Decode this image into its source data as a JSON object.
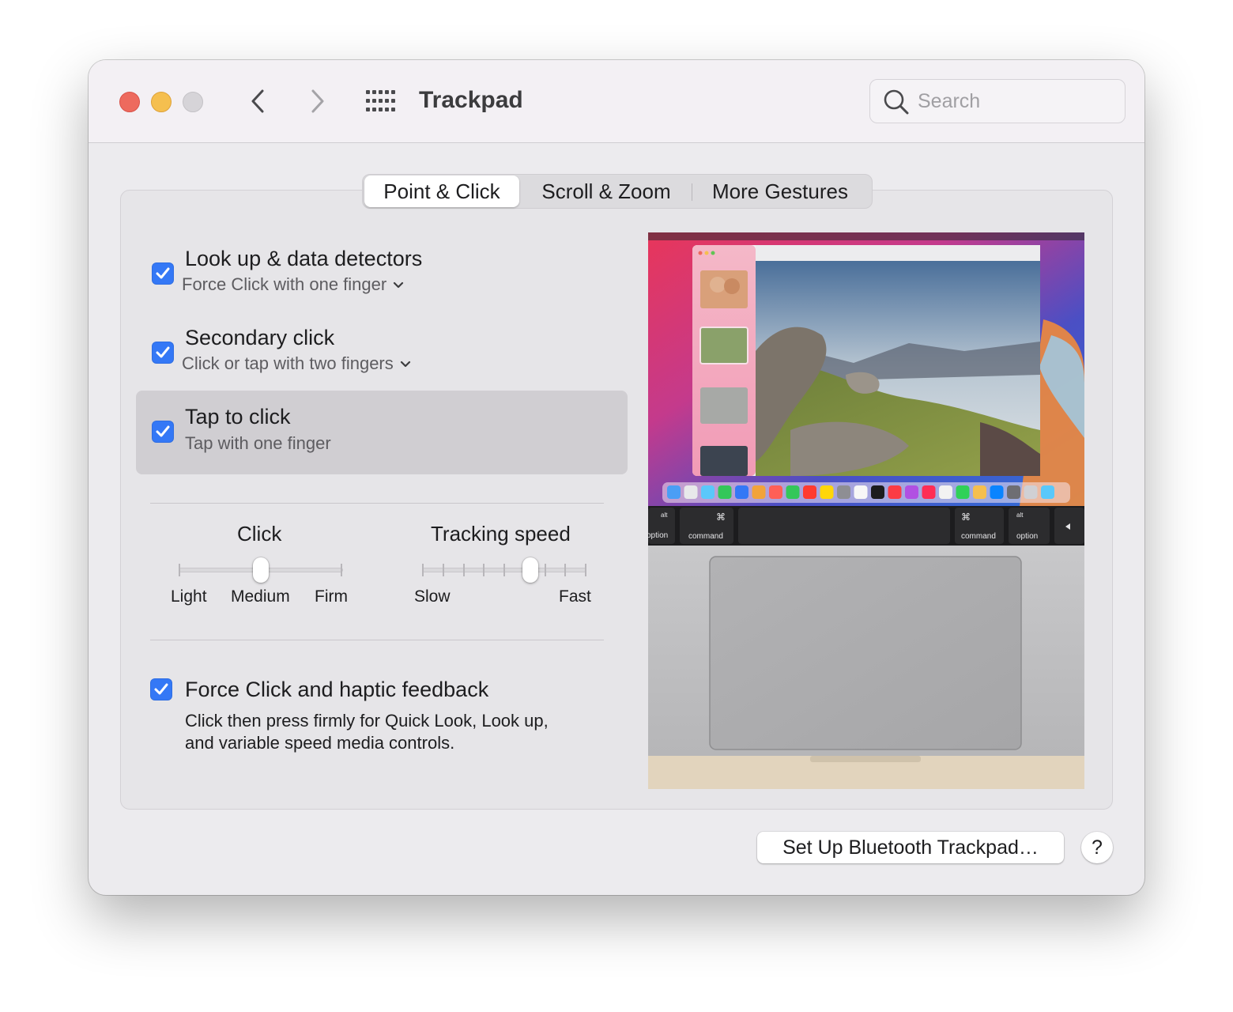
{
  "window": {
    "title": "Trackpad"
  },
  "search": {
    "placeholder": "Search"
  },
  "tabs": [
    {
      "label": "Point & Click",
      "active": true
    },
    {
      "label": "Scroll & Zoom",
      "active": false
    },
    {
      "label": "More Gestures",
      "active": false
    }
  ],
  "options": [
    {
      "title": "Look up & data detectors",
      "subtitle": "Force Click with one finger",
      "checked": true,
      "has_menu": true
    },
    {
      "title": "Secondary click",
      "subtitle": "Click or tap with two fingers",
      "checked": true,
      "has_menu": true
    },
    {
      "title": "Tap to click",
      "subtitle": "Tap with one finger",
      "checked": true,
      "has_menu": false
    }
  ],
  "sliders": {
    "click": {
      "label": "Click",
      "ticks": [
        "Light",
        "Medium",
        "Firm"
      ],
      "value_index": 1
    },
    "tracking": {
      "label": "Tracking speed",
      "min_label": "Slow",
      "max_label": "Fast",
      "value_fraction": 0.66
    }
  },
  "force_click": {
    "title": "Force Click and haptic feedback",
    "desc_line1": "Click then press firmly for Quick Look, Look up,",
    "desc_line2": "and variable speed media controls.",
    "checked": true
  },
  "preview": {
    "keys": {
      "alt": "alt",
      "option": "option",
      "command": "command",
      "cmd_symbol": "⌘"
    }
  },
  "buttons": {
    "setup": "Set Up Bluetooth Trackpad…",
    "help": "?"
  },
  "colors": {
    "accent": "#3478f6",
    "close": "#ed6a5e",
    "minimize": "#f5bf4f"
  }
}
